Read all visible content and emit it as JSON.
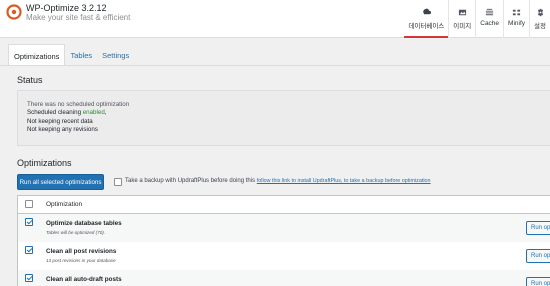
{
  "app": {
    "title": "WP-Optimize 3.2.12",
    "subtitle": "Make your site fast & efficient"
  },
  "topnav": [
    {
      "label": "데이터베이스",
      "icon": "database-icon",
      "active": true
    },
    {
      "label": "이미지",
      "icon": "image-icon",
      "active": false
    },
    {
      "label": "Cache",
      "icon": "cache-icon",
      "active": false
    },
    {
      "label": "Minify",
      "icon": "minify-icon",
      "active": false
    },
    {
      "label": "설정",
      "icon": "settings-icon",
      "active": false
    }
  ],
  "tabs": [
    {
      "label": "Optimizations",
      "active": true
    },
    {
      "label": "Tables",
      "active": false
    },
    {
      "label": "Settings",
      "active": false
    }
  ],
  "status": {
    "heading": "Status",
    "lines": {
      "l1": "There was no scheduled optimization",
      "l2_prefix": "Scheduled cleaning ",
      "l2_enabled": "enabled",
      "l2_suffix": ",",
      "l3": "Not keeping recent data",
      "l4": "Not keeping any revisions"
    }
  },
  "optimizations": {
    "heading": "Optimizations",
    "run_all_label": "Run all selected optimizations",
    "backup_text": "Take a backup with UpdraftPlus before doing this",
    "backup_link": "follow this link to install UpdraftPlus, to take a backup before optimization",
    "column_header": "Optimization",
    "rows": [
      {
        "title": "Optimize database tables",
        "sub": "Tables will be optimized (70).",
        "checked": true,
        "button": "Run optimization"
      },
      {
        "title": "Clean all post revisions",
        "sub": "13 post revisions in your database",
        "checked": true,
        "button": "Run optimization"
      },
      {
        "title": "Clean all auto-draft posts",
        "sub": "",
        "checked": true,
        "button": "Run optimization"
      }
    ]
  },
  "colors": {
    "accent": "#2271b1",
    "active_tab_underline": "#d63638",
    "enabled_green": "#2e8b2e"
  }
}
